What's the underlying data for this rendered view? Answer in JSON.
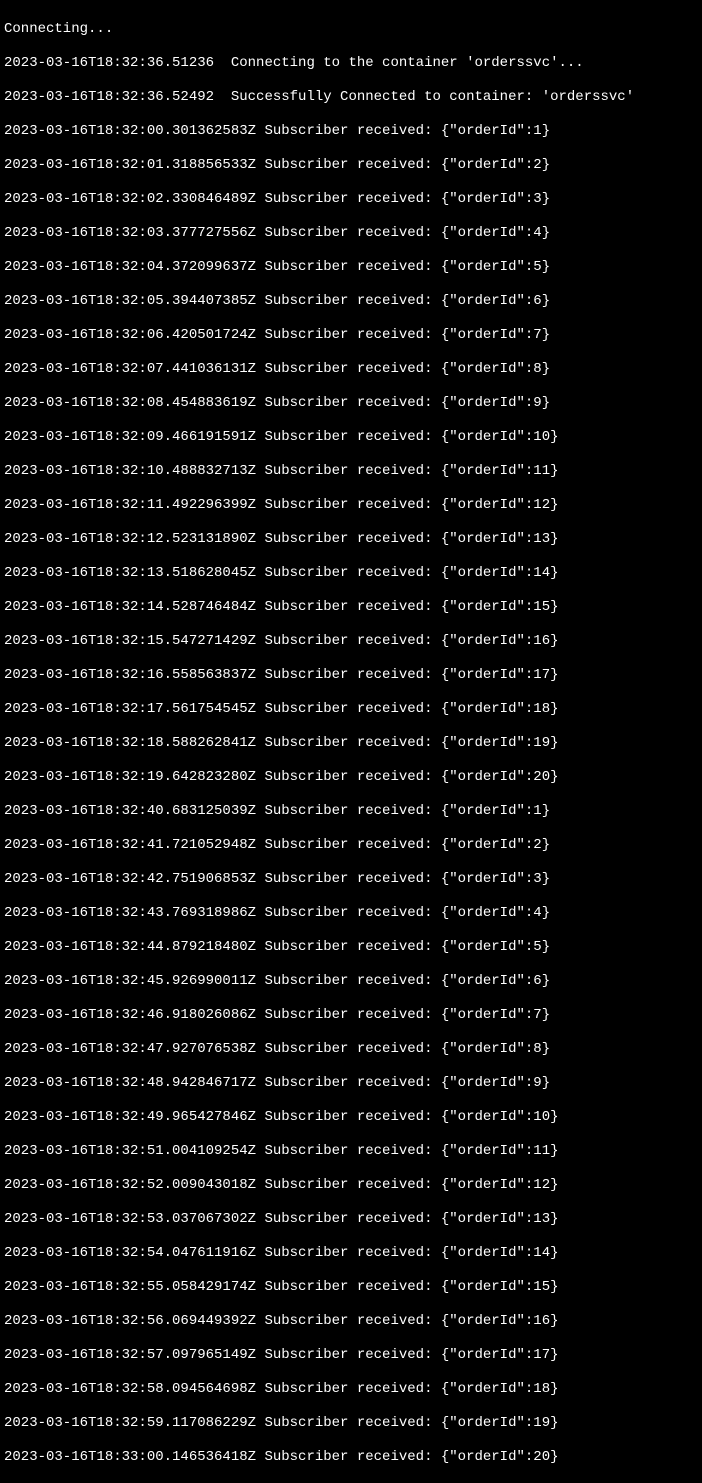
{
  "header": {
    "connecting": "Connecting...",
    "line1": "2023-03-16T18:32:36.51236  Connecting to the container 'orderssvc'...",
    "line2": "2023-03-16T18:32:36.52492  Successfully Connected to container: 'orderssvc'"
  },
  "logs": [
    "2023-03-16T18:32:00.301362583Z Subscriber received: {\"orderId\":1}",
    "2023-03-16T18:32:01.318856533Z Subscriber received: {\"orderId\":2}",
    "2023-03-16T18:32:02.330846489Z Subscriber received: {\"orderId\":3}",
    "2023-03-16T18:32:03.377727556Z Subscriber received: {\"orderId\":4}",
    "2023-03-16T18:32:04.372099637Z Subscriber received: {\"orderId\":5}",
    "2023-03-16T18:32:05.394407385Z Subscriber received: {\"orderId\":6}",
    "2023-03-16T18:32:06.420501724Z Subscriber received: {\"orderId\":7}",
    "2023-03-16T18:32:07.441036131Z Subscriber received: {\"orderId\":8}",
    "2023-03-16T18:32:08.454883619Z Subscriber received: {\"orderId\":9}",
    "2023-03-16T18:32:09.466191591Z Subscriber received: {\"orderId\":10}",
    "2023-03-16T18:32:10.488832713Z Subscriber received: {\"orderId\":11}",
    "2023-03-16T18:32:11.492296399Z Subscriber received: {\"orderId\":12}",
    "2023-03-16T18:32:12.523131890Z Subscriber received: {\"orderId\":13}",
    "2023-03-16T18:32:13.518628045Z Subscriber received: {\"orderId\":14}",
    "2023-03-16T18:32:14.528746484Z Subscriber received: {\"orderId\":15}",
    "2023-03-16T18:32:15.547271429Z Subscriber received: {\"orderId\":16}",
    "2023-03-16T18:32:16.558563837Z Subscriber received: {\"orderId\":17}",
    "2023-03-16T18:32:17.561754545Z Subscriber received: {\"orderId\":18}",
    "2023-03-16T18:32:18.588262841Z Subscriber received: {\"orderId\":19}",
    "2023-03-16T18:32:19.642823280Z Subscriber received: {\"orderId\":20}",
    "2023-03-16T18:32:40.683125039Z Subscriber received: {\"orderId\":1}",
    "2023-03-16T18:32:41.721052948Z Subscriber received: {\"orderId\":2}",
    "2023-03-16T18:32:42.751906853Z Subscriber received: {\"orderId\":3}",
    "2023-03-16T18:32:43.769318986Z Subscriber received: {\"orderId\":4}",
    "2023-03-16T18:32:44.879218480Z Subscriber received: {\"orderId\":5}",
    "2023-03-16T18:32:45.926990011Z Subscriber received: {\"orderId\":6}",
    "2023-03-16T18:32:46.918026086Z Subscriber received: {\"orderId\":7}",
    "2023-03-16T18:32:47.927076538Z Subscriber received: {\"orderId\":8}",
    "2023-03-16T18:32:48.942846717Z Subscriber received: {\"orderId\":9}",
    "2023-03-16T18:32:49.965427846Z Subscriber received: {\"orderId\":10}",
    "2023-03-16T18:32:51.004109254Z Subscriber received: {\"orderId\":11}",
    "2023-03-16T18:32:52.009043018Z Subscriber received: {\"orderId\":12}",
    "2023-03-16T18:32:53.037067302Z Subscriber received: {\"orderId\":13}",
    "2023-03-16T18:32:54.047611916Z Subscriber received: {\"orderId\":14}",
    "2023-03-16T18:32:55.058429174Z Subscriber received: {\"orderId\":15}",
    "2023-03-16T18:32:56.069449392Z Subscriber received: {\"orderId\":16}",
    "2023-03-16T18:32:57.097965149Z Subscriber received: {\"orderId\":17}",
    "2023-03-16T18:32:58.094564698Z Subscriber received: {\"orderId\":18}",
    "2023-03-16T18:32:59.117086229Z Subscriber received: {\"orderId\":19}",
    "2023-03-16T18:33:00.146536418Z Subscriber received: {\"orderId\":20}"
  ]
}
